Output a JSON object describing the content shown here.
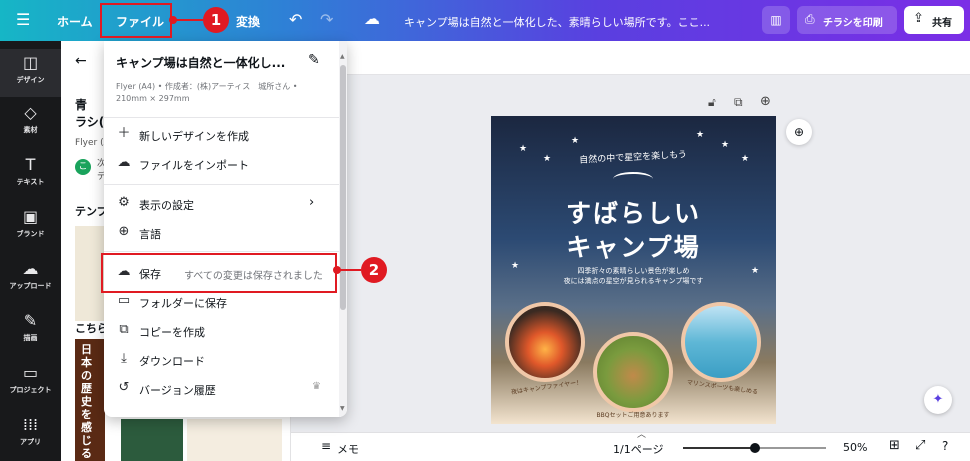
{
  "topbar": {
    "home": "ホーム",
    "file": "ファイル",
    "convert_partial": "変換",
    "doc_title": "キャンプ場は自然と一体化した、素晴らしい場所です。ここ...",
    "print_label": "チラシを印刷",
    "share_label": "共有"
  },
  "sidebar": {
    "items": [
      {
        "label": "デザイン",
        "icon": "layout-icon"
      },
      {
        "label": "素材",
        "icon": "shapes-icon"
      },
      {
        "label": "テキスト",
        "icon": "text-icon"
      },
      {
        "label": "ブランド",
        "icon": "brand-icon"
      },
      {
        "label": "アップロード",
        "icon": "upload-icon"
      },
      {
        "label": "描画",
        "icon": "draw-icon"
      },
      {
        "label": "プロジェクト",
        "icon": "folder-icon"
      },
      {
        "label": "アプリ",
        "icon": "apps-icon"
      }
    ]
  },
  "panel": {
    "title_partial1": "青",
    "title_partial2": "ラシ(A",
    "subtitle_partial": "Flyer (A",
    "avatar_letter": "こ",
    "text_fragment1": "次",
    "text_fragment2": "デ",
    "template_label": "テンプ",
    "section_label": "こちら",
    "thumb_text": "日本の歴史を感じる"
  },
  "menu": {
    "title": "キャンプ場は自然と一体化し...",
    "meta_line1": "Flyer (A4) • 作成者：(株)アーティス　城所さん •",
    "meta_line2": "210mm × 297mm",
    "items": [
      {
        "label": "新しいデザインを作成"
      },
      {
        "label": "ファイルをインポート"
      },
      {
        "label": "表示の設定"
      },
      {
        "label": "言語"
      },
      {
        "label": "保存",
        "status": "すべての変更は保存されました"
      },
      {
        "label": "フォルダーに保存"
      },
      {
        "label": "コピーを作成"
      },
      {
        "label": "ダウンロード"
      },
      {
        "label": "バージョン履歴"
      }
    ]
  },
  "annotations": {
    "badge1": "1",
    "badge2": "2",
    "color": "#e01a22"
  },
  "flyer": {
    "headline_top": "自然の中で星空を楽しもう",
    "headline_main1": "すばらしい",
    "headline_main2": "キャンプ場",
    "tagline1": "四季折々の素晴らしい景色が楽しめ",
    "tagline2": "夜には満点の星空が見られるキャンプ場です",
    "caption1": "夜はキャンプファイヤー！",
    "caption2": "BBQセットご用意あります",
    "caption3": "マリンスポーツも楽しめる"
  },
  "bottombar": {
    "notes": "メモ",
    "page_count": "1/1ページ",
    "zoom": "50%",
    "zoom_fraction": 0.5
  }
}
